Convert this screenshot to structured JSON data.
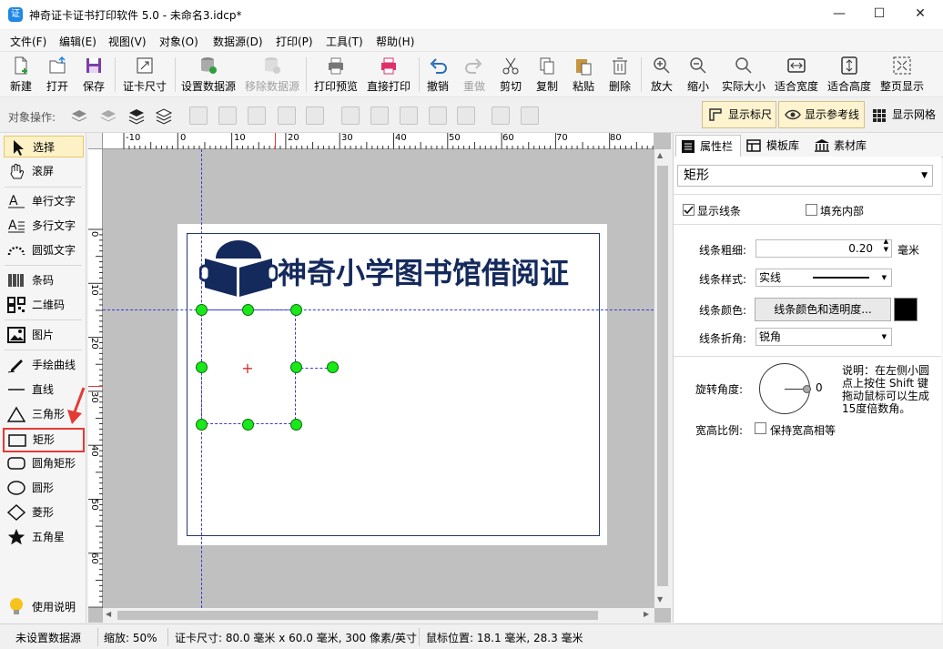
{
  "window": {
    "title": "神奇证卡证书打印软件 5.0 - 未命名3.idcp*",
    "minimize": "—",
    "maximize": "☐",
    "close": "✕"
  },
  "menu": [
    "文件(F)",
    "编辑(E)",
    "视图(V)",
    "对象(O)",
    "数据源(D)",
    "打印(P)",
    "工具(T)",
    "帮助(H)"
  ],
  "toolbar": {
    "new": "新建",
    "open": "打开",
    "save": "保存",
    "card_size": "证卡尺寸",
    "set_datasource": "设置数据源",
    "remove_datasource": "移除数据源",
    "print_preview": "打印预览",
    "direct_print": "直接打印",
    "undo": "撤销",
    "redo": "重做",
    "cut": "剪切",
    "copy": "复制",
    "paste": "粘贴",
    "delete": "删除",
    "zoom_in": "放大",
    "zoom_out": "缩小",
    "actual_size": "实际大小",
    "fit_width": "适合宽度",
    "fit_height": "适合高度",
    "fit_page": "整页显示"
  },
  "objbar": {
    "label": "对象操作:",
    "show_ruler": "显示标尺",
    "show_guides": "显示参考线",
    "show_grid": "显示网格"
  },
  "tools": {
    "select": "选择",
    "scroll": "滚屏",
    "single_text": "单行文字",
    "multi_text": "多行文字",
    "arc_text": "圆弧文字",
    "barcode": "条码",
    "qrcode": "二维码",
    "image": "图片",
    "freehand": "手绘曲线",
    "line": "直线",
    "triangle": "三角形",
    "rectangle": "矩形",
    "round_rect": "圆角矩形",
    "circle": "圆形",
    "diamond": "菱形",
    "star": "五角星",
    "help": "使用说明"
  },
  "rulers": {
    "h_labels": [
      "-10",
      "0",
      "10",
      "20",
      "30",
      "40",
      "50",
      "60",
      "70",
      "80"
    ],
    "v_labels": [
      "0",
      "10",
      "20",
      "30",
      "40",
      "50",
      "60"
    ]
  },
  "card": {
    "title": "神奇小学图书馆借阅证"
  },
  "panel": {
    "tabs": [
      "属性栏",
      "模板库",
      "素材库"
    ],
    "object_type": "矩形",
    "show_line": "显示线条",
    "fill_inside": "填充内部",
    "line_width_label": "线条粗细:",
    "line_width_value": "0.20",
    "line_width_unit": "毫米",
    "line_style_label": "线条样式:",
    "line_style_value": "实线",
    "line_color_label": "线条颜色:",
    "line_color_button": "线条颜色和透明度...",
    "line_corner_label": "线条折角:",
    "line_corner_value": "锐角",
    "rotation_label": "旋转角度:",
    "rotation_value": "0",
    "note": "说明：在左侧小圆点上按住 Shift 键拖动鼠标可以生成15度倍数角。",
    "aspect_label": "宽高比例:",
    "keep_aspect": "保持宽高相等"
  },
  "status": {
    "datasource": "未设置数据源",
    "zoom": "缩放: 50%",
    "card_size": "证卡尺寸: 80.0 毫米 x 60.0 毫米, 300 像素/英寸",
    "mouse": "鼠标位置: 18.1 毫米, 28.3 毫米"
  },
  "colors": {
    "accent": "#1e88e5",
    "card_text": "#14295c",
    "handle": "#19e819",
    "highlight": "#e53935",
    "line_color": "#000000"
  }
}
